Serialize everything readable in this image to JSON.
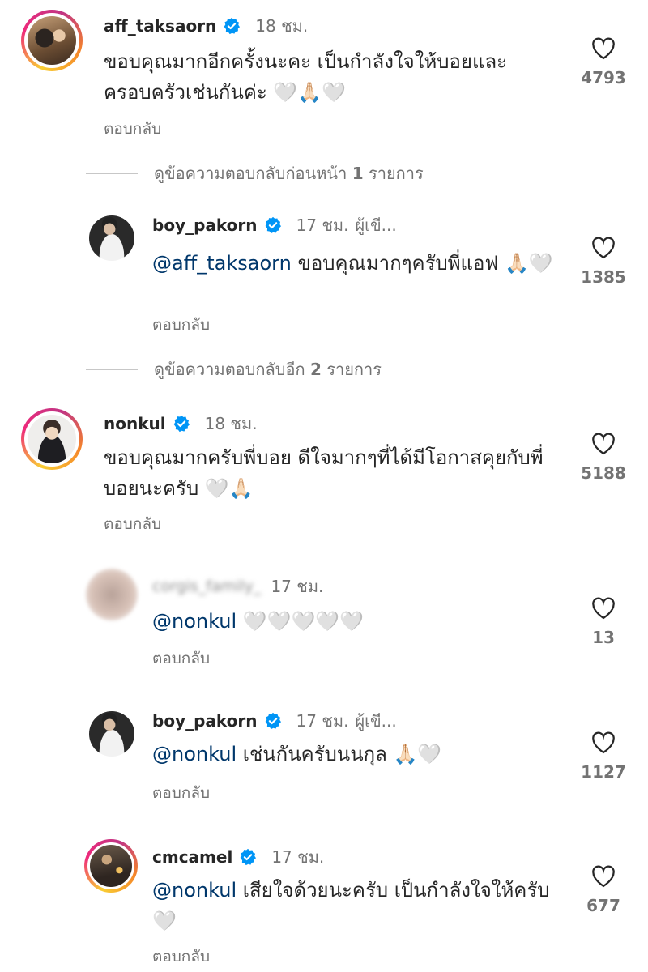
{
  "comments": [
    {
      "username": "aff_taksaorn",
      "verified": true,
      "time": "18 ชม.",
      "text": "ขอบคุณมากอีกครั้งนะคะ เป็นกำลังใจให้บอยและครอบครัวเช่นกันค่ะ 🤍🙏🏻🤍",
      "reply_label": "ตอบกลับ",
      "likes": "4793"
    },
    {
      "username": "boy_pakorn",
      "verified": true,
      "time": "17 ชม.",
      "author_label": "ผู้เขี...",
      "mention": "@aff_taksaorn",
      "text": " ขอบคุณมากๆครับพี่แอฟ 🙏🏻🤍",
      "reply_label": "ตอบกลับ",
      "likes": "1385"
    },
    {
      "username": "nonkul",
      "verified": true,
      "time": "18 ชม.",
      "text": "ขอบคุณมากครับพี่บอย ดีใจมากๆที่ได้มีโอกาสคุยกับพี่บอยนะครับ 🤍🙏🏻",
      "reply_label": "ตอบกลับ",
      "likes": "5188"
    },
    {
      "username": "corgis_family_",
      "verified": false,
      "time": "17 ชม.",
      "mention": "@nonkul",
      "text": " 🤍🤍🤍🤍🤍",
      "reply_label": "ตอบกลับ",
      "likes": "13"
    },
    {
      "username": "boy_pakorn",
      "verified": true,
      "time": "17 ชม.",
      "author_label": "ผู้เขี...",
      "mention": "@nonkul",
      "text": " เช่นกันครับนนกุล 🙏🏻🤍",
      "reply_label": "ตอบกลับ",
      "likes": "1127"
    },
    {
      "username": "cmcamel",
      "verified": true,
      "time": "17 ชม.",
      "mention": "@nonkul",
      "text": " เสียใจด้วยนะครับ เป็นกำลังใจให้ครับ 🤍",
      "reply_label": "ตอบกลับ",
      "likes": "677"
    }
  ],
  "threads": [
    {
      "label": "ดูข้อความตอบกลับก่อนหน้า",
      "count": "1",
      "suffix": "รายการ"
    },
    {
      "label": "ดูข้อความตอบกลับอีก",
      "count": "2",
      "suffix": "รายการ"
    }
  ],
  "colors": {
    "verified_badge": "#0095f6",
    "mention": "#00376b",
    "secondary_text": "#737373"
  },
  "icons": {
    "like": "heart-outline-icon",
    "verified": "verified-badge-icon"
  }
}
